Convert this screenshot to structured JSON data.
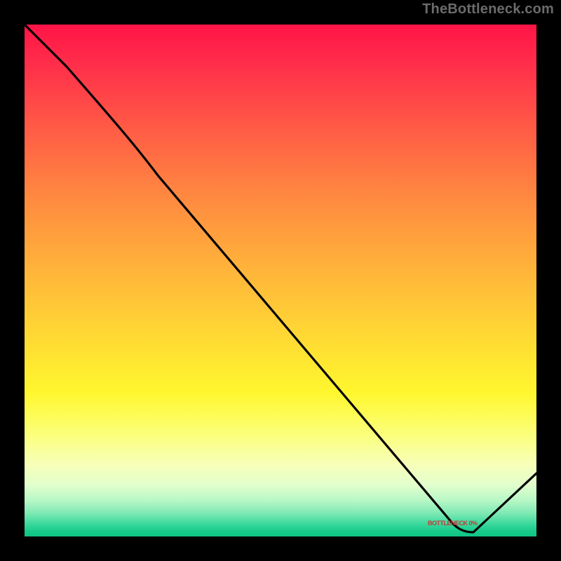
{
  "watermark": "TheBottleneck.com",
  "chart_data": {
    "type": "line",
    "title": "",
    "xlabel": "",
    "ylabel": "",
    "x": [
      0,
      25,
      80,
      87,
      100
    ],
    "values": [
      100,
      80,
      2,
      0,
      12
    ],
    "ylim": [
      0,
      100
    ],
    "xlim": [
      0,
      100
    ],
    "grid": false,
    "marker_label": "BOTTLENECK 0%",
    "marker_x": 87
  },
  "colors": {
    "line": "#000000",
    "marker_text": "#c23a3a",
    "frame": "#000000"
  }
}
